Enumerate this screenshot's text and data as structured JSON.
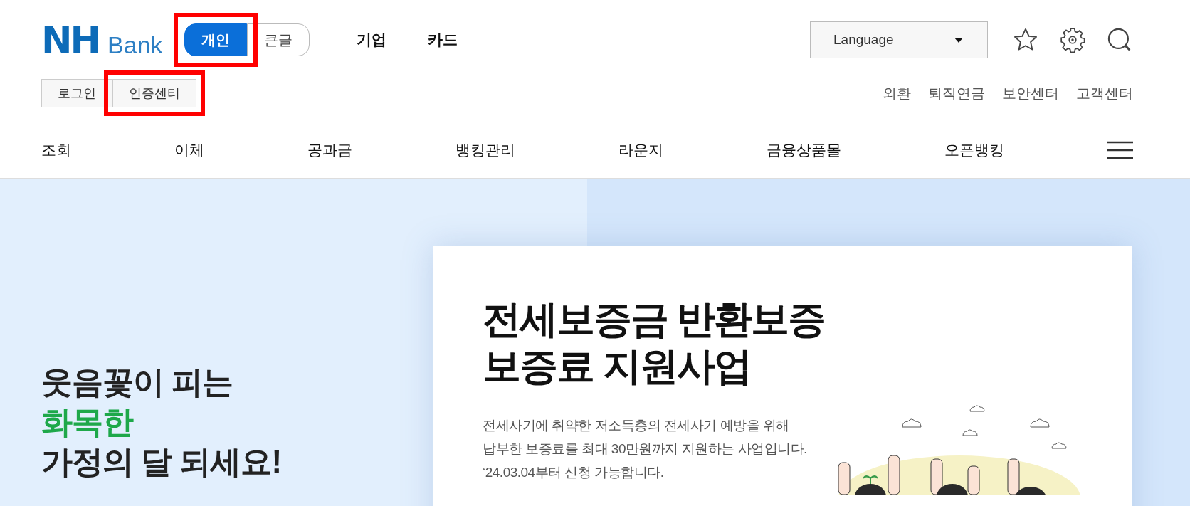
{
  "logo": {
    "mark": "NH",
    "word": "Bank"
  },
  "mode_toggle": [
    {
      "label": "개인",
      "selected": true,
      "highlighted": true
    },
    {
      "label": "큰글",
      "selected": false,
      "highlighted": false
    }
  ],
  "top_links": [
    "기업",
    "카드"
  ],
  "language_select": {
    "value": "Language"
  },
  "auth_buttons": [
    {
      "label": "로그인",
      "highlighted": false
    },
    {
      "label": "인증센터",
      "highlighted": true
    }
  ],
  "utility_links": [
    "외환",
    "퇴직연금",
    "보안센터",
    "고객센터"
  ],
  "nav": [
    "조회",
    "이체",
    "공과금",
    "뱅킹관리",
    "라운지",
    "금융상품몰",
    "오픈뱅킹"
  ],
  "hero": {
    "left_lines": [
      {
        "text": "웃음꽃이 피는",
        "accent": false
      },
      {
        "text": "화목한",
        "accent": true
      },
      {
        "text": "가정의 달 되세요!",
        "accent": false
      }
    ],
    "card": {
      "title_lines": [
        "전세보증금 반환보증",
        "보증료 지원사업"
      ],
      "body_lines": [
        "전세사기에 취약한 저소득층의 전세사기 예방을 위해",
        "납부한 보증료를 최대 30만원까지 지원하는 사업입니다.",
        "‘24.03.04부터 신청 가능합니다."
      ]
    }
  }
}
